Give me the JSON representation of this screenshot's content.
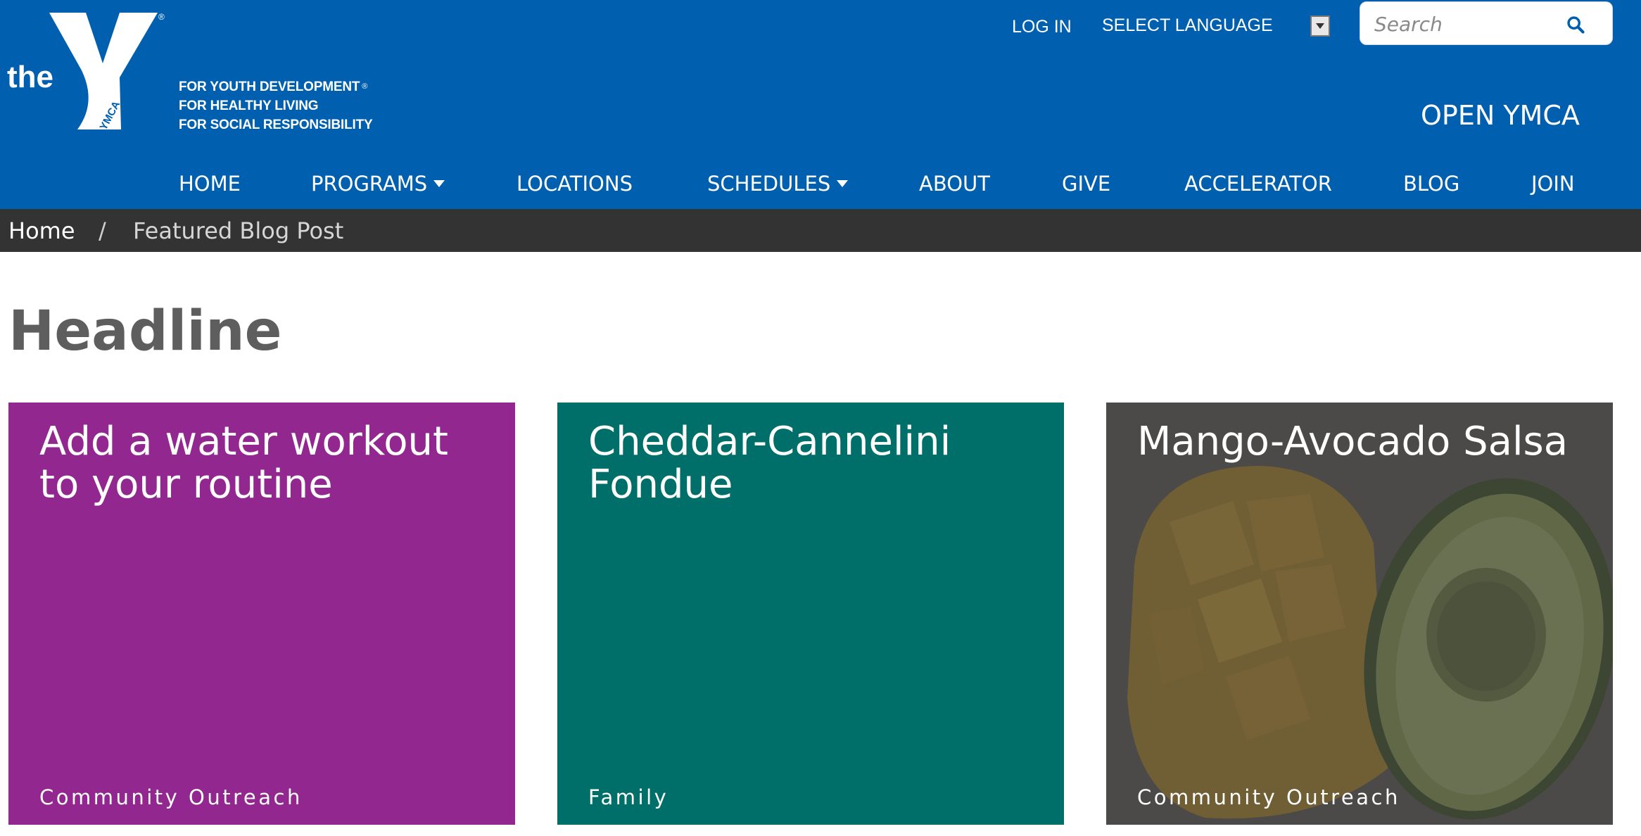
{
  "brand": {
    "logo_word": "the",
    "logo_sub": "YMCA",
    "taglines": [
      "FOR YOUTH DEVELOPMENT",
      "FOR HEALTHY LIVING",
      "FOR SOCIAL RESPONSIBILITY"
    ],
    "color": "#0060af"
  },
  "utility": {
    "login_label": "LOG IN",
    "language_label": "SELECT LANGUAGE",
    "search_placeholder": "Search",
    "open_ymca_label": "OPEN YMCA"
  },
  "nav": {
    "items": [
      {
        "label": "HOME",
        "has_dropdown": false
      },
      {
        "label": "PROGRAMS",
        "has_dropdown": true
      },
      {
        "label": "LOCATIONS",
        "has_dropdown": false
      },
      {
        "label": "SCHEDULES",
        "has_dropdown": true
      },
      {
        "label": "ABOUT",
        "has_dropdown": false
      },
      {
        "label": "GIVE",
        "has_dropdown": false
      },
      {
        "label": "ACCELERATOR",
        "has_dropdown": false
      },
      {
        "label": "BLOG",
        "has_dropdown": false
      },
      {
        "label": "JOIN",
        "has_dropdown": false
      }
    ]
  },
  "breadcrumb": {
    "home": "Home",
    "separator": "/",
    "current": "Featured Blog Post"
  },
  "main": {
    "headline": "Headline",
    "cards": [
      {
        "title": "Add a water workout to your routine",
        "category": "Community Outreach",
        "color": "#92278f"
      },
      {
        "title": "Cheddar-Cannelini Fondue",
        "category": "Family",
        "color": "#006f69"
      },
      {
        "title": "Mango-Avocado Salsa",
        "category": "Community Outreach",
        "color": "#3a3a3a",
        "image": "mango-avocado-photo"
      }
    ]
  }
}
